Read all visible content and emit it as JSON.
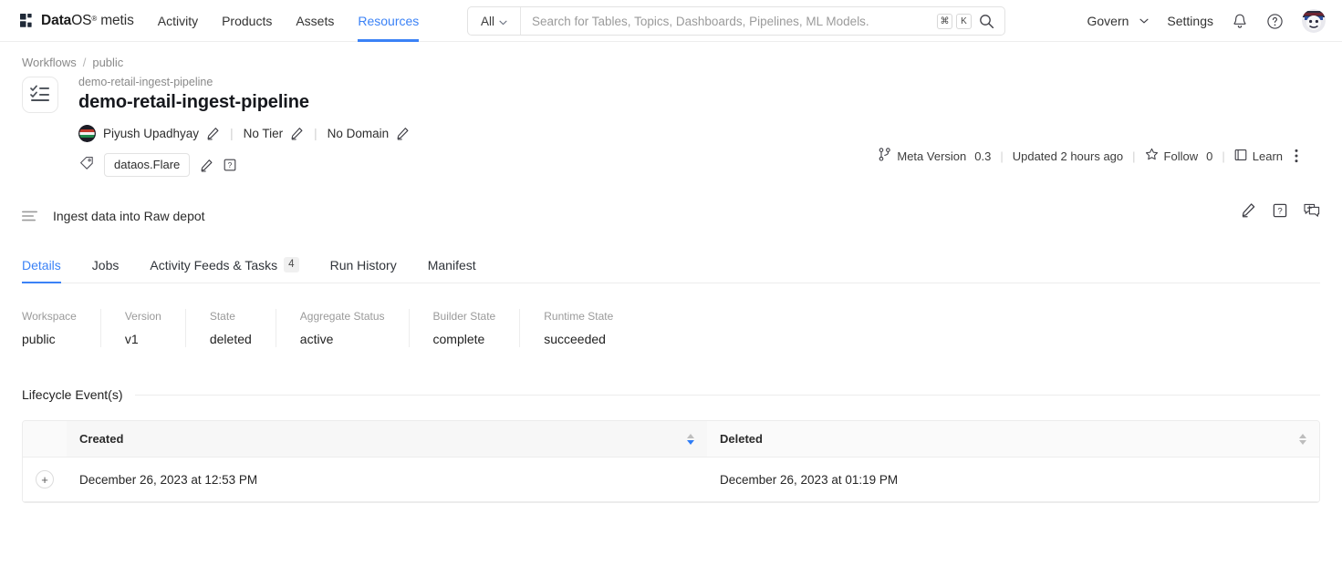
{
  "topnav": {
    "brand": {
      "data": "Data",
      "os": "OS",
      "registered": "®",
      "product": "metis",
      "logo_icon": "dataos-logo-icon"
    },
    "links": [
      {
        "label": "Activity",
        "active": false
      },
      {
        "label": "Products",
        "active": false
      },
      {
        "label": "Assets",
        "active": false
      },
      {
        "label": "Resources",
        "active": true
      }
    ],
    "search": {
      "scope": "All",
      "placeholder": "Search for Tables, Topics, Dashboards, Pipelines, ML Models.",
      "value": "",
      "kbd_meta": "⌘",
      "kbd_key": "K"
    },
    "right": {
      "govern": "Govern",
      "settings": "Settings",
      "bell_icon": "notification-bell-icon",
      "help_icon": "help-circle-icon",
      "avatar_icon": "user-avatar"
    },
    "accent": "#3b82f6"
  },
  "breadcrumb": {
    "items": [
      "Workflows",
      "public"
    ],
    "separator": "/"
  },
  "entity": {
    "icon": "checklist-icon",
    "subtitle": "demo-retail-ingest-pipeline",
    "title": "demo-retail-ingest-pipeline",
    "owner": "Piyush Upadhyay",
    "tier": "No Tier",
    "domain": "No Domain",
    "tag": "dataos.Flare",
    "edit_icon": "pencil-icon",
    "help_icon": "question-box-icon",
    "tag_icon": "tag-icon"
  },
  "meta": {
    "version_icon": "branch-icon",
    "version_label": "Meta Version",
    "version_value": "0.3",
    "updated": "Updated 2 hours ago",
    "follow_icon": "star-icon",
    "follow_label": "Follow",
    "follow_count": "0",
    "learn_icon": "book-icon",
    "learn_label": "Learn",
    "more_icon": "kebab-menu-icon",
    "separator": "|"
  },
  "description": {
    "icon": "description-lines-icon",
    "text": "Ingest data into Raw depot",
    "actions": [
      {
        "icon": "pencil-icon",
        "name": "edit-description-button"
      },
      {
        "icon": "question-box-icon",
        "name": "description-help-button"
      },
      {
        "icon": "add-comment-icon",
        "name": "add-comment-button"
      }
    ]
  },
  "tabs": [
    {
      "label": "Details",
      "count": null,
      "active": true
    },
    {
      "label": "Jobs",
      "count": null,
      "active": false
    },
    {
      "label": "Activity Feeds & Tasks",
      "count": "4",
      "active": false
    },
    {
      "label": "Run History",
      "count": null,
      "active": false
    },
    {
      "label": "Manifest",
      "count": null,
      "active": false
    }
  ],
  "stats": [
    {
      "label": "Workspace",
      "value": "public"
    },
    {
      "label": "Version",
      "value": "v1"
    },
    {
      "label": "State",
      "value": "deleted"
    },
    {
      "label": "Aggregate Status",
      "value": "active"
    },
    {
      "label": "Builder State",
      "value": "complete"
    },
    {
      "label": "Runtime State",
      "value": "succeeded"
    }
  ],
  "lifecycle": {
    "section_title": "Lifecycle Event(s)",
    "columns": [
      {
        "label": "Created",
        "sorted": "desc"
      },
      {
        "label": "Deleted",
        "sorted": "none"
      }
    ],
    "rows": [
      {
        "expander": "+",
        "created": "December 26, 2023 at 12:53 PM",
        "deleted": "December 26, 2023 at 01:19 PM"
      }
    ]
  }
}
